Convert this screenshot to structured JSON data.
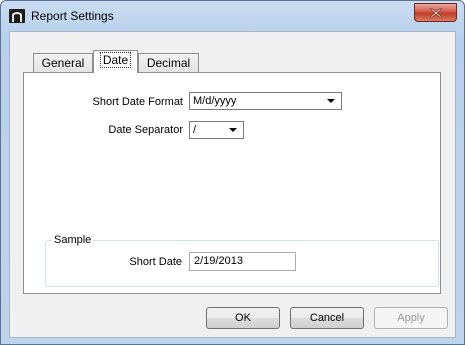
{
  "window": {
    "title": "Report Settings"
  },
  "tabs": [
    {
      "label": "General",
      "active": false
    },
    {
      "label": "Date",
      "active": true
    },
    {
      "label": "Decimal",
      "active": false
    }
  ],
  "date_tab": {
    "short_date_format": {
      "label": "Short Date Format",
      "value": "M/d/yyyy"
    },
    "date_separator": {
      "label": "Date Separator",
      "value": "/"
    }
  },
  "sample": {
    "legend": "Sample",
    "short_date_label": "Short Date",
    "short_date_value": "2/19/2013"
  },
  "buttons": {
    "ok": "OK",
    "cancel": "Cancel",
    "apply": "Apply",
    "apply_enabled": false
  },
  "icons": {
    "app": "report-app-icon",
    "close": "close-icon",
    "dropdown": "chevron-down-icon"
  }
}
